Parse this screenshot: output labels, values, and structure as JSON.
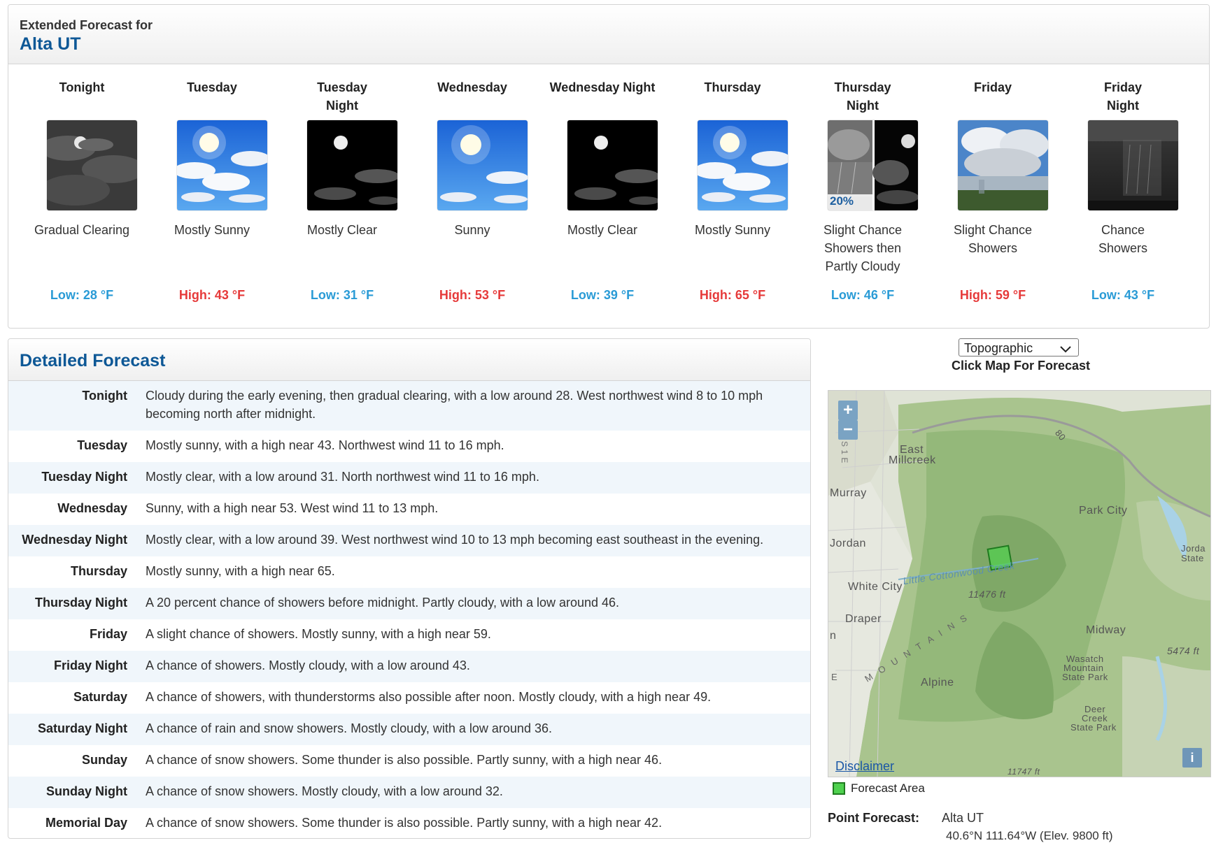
{
  "extended": {
    "subtitle": "Extended Forecast for",
    "location": "Alta UT",
    "days": [
      {
        "period": "Tonight",
        "short": "Gradual Clearing",
        "temp": "Low: 28 °F",
        "kind": "low",
        "icon": "night-cloudy-clearing-icon"
      },
      {
        "period": "Tuesday",
        "short": "Mostly Sunny",
        "temp": "High: 43 °F",
        "kind": "high",
        "icon": "mostly-sunny-icon"
      },
      {
        "period": "Tuesday Night",
        "short": "Mostly Clear",
        "temp": "Low: 31 °F",
        "kind": "low",
        "icon": "mostly-clear-night-icon"
      },
      {
        "period": "Wednesday",
        "short": "Sunny",
        "temp": "High: 53 °F",
        "kind": "high",
        "icon": "sunny-icon"
      },
      {
        "period": "Wednesday Night",
        "short": "Mostly Clear",
        "temp": "Low: 39 °F",
        "kind": "low",
        "icon": "mostly-clear-night-icon"
      },
      {
        "period": "Thursday",
        "short": "Mostly Sunny",
        "temp": "High: 65 °F",
        "kind": "high",
        "icon": "mostly-sunny-icon"
      },
      {
        "period": "Thursday Night",
        "short": "Slight Chance Showers then Partly Cloudy",
        "temp": "Low: 46 °F",
        "kind": "low",
        "icon": "showers-then-partly-cloudy-icon",
        "pop": "20%"
      },
      {
        "period": "Friday",
        "short": "Slight Chance Showers",
        "temp": "High: 59 °F",
        "kind": "high",
        "icon": "slight-chance-showers-icon"
      },
      {
        "period": "Friday Night",
        "short": "Chance Showers",
        "temp": "Low: 43 °F",
        "kind": "low",
        "icon": "chance-showers-night-icon"
      }
    ]
  },
  "detailed": {
    "title": "Detailed Forecast",
    "rows": [
      {
        "label": "Tonight",
        "text": "Cloudy during the early evening, then gradual clearing, with a low around 28. West northwest wind 8 to 10 mph becoming north after midnight."
      },
      {
        "label": "Tuesday",
        "text": "Mostly sunny, with a high near 43. Northwest wind 11 to 16 mph."
      },
      {
        "label": "Tuesday Night",
        "text": "Mostly clear, with a low around 31. North northwest wind 11 to 16 mph."
      },
      {
        "label": "Wednesday",
        "text": "Sunny, with a high near 53. West wind 11 to 13 mph."
      },
      {
        "label": "Wednesday Night",
        "text": "Mostly clear, with a low around 39. West northwest wind 10 to 13 mph becoming east southeast in the evening."
      },
      {
        "label": "Thursday",
        "text": "Mostly sunny, with a high near 65."
      },
      {
        "label": "Thursday Night",
        "text": "A 20 percent chance of showers before midnight. Partly cloudy, with a low around 46."
      },
      {
        "label": "Friday",
        "text": "A slight chance of showers. Mostly sunny, with a high near 59."
      },
      {
        "label": "Friday Night",
        "text": "A chance of showers. Mostly cloudy, with a low around 43."
      },
      {
        "label": "Saturday",
        "text": "A chance of showers, with thunderstorms also possible after noon. Mostly cloudy, with a high near 49."
      },
      {
        "label": "Saturday Night",
        "text": "A chance of rain and snow showers. Mostly cloudy, with a low around 36."
      },
      {
        "label": "Sunday",
        "text": "A chance of snow showers. Some thunder is also possible. Partly sunny, with a high near 46."
      },
      {
        "label": "Sunday Night",
        "text": "A chance of snow showers. Mostly cloudy, with a low around 32."
      },
      {
        "label": "Memorial Day",
        "text": "A chance of snow showers. Some thunder is also possible. Partly sunny, with a high near 42."
      }
    ]
  },
  "map": {
    "type_selected": "Topographic",
    "click_label": "Click Map For Forecast",
    "zoom_in": "+",
    "zoom_out": "−",
    "disclaimer": "Disclaimer",
    "info": "i",
    "places": {
      "east_millcreek_1": "East",
      "east_millcreek_2": "Millcreek",
      "murray": "Murray",
      "jordan": "Jordan",
      "park_city": "Park City",
      "jordanelle_1": "Jorda",
      "jordanelle_2": "State",
      "white_city": "White City",
      "draper": "Draper",
      "midway": "Midway",
      "wasatch_1": "Wasatch",
      "wasatch_2": "Mountain",
      "wasatch_3": "State Park",
      "alpine": "Alpine",
      "deer_1": "Deer",
      "deer_2": "Creek",
      "deer_3": "State Park",
      "creek": "Little Cottonwood Creek",
      "elev_1": "11476 ft",
      "elev_2": "5474 ft",
      "elev_3": "11747 ft",
      "mountains": "M O U N T A I N S",
      "hwy_80": "80",
      "hwy_215": "S 1 E",
      "left_n": "n",
      "left_e": "E"
    },
    "legend": "Forecast Area",
    "forecast_area_color": "#4fd14f"
  },
  "point": {
    "label": "Point Forecast:",
    "name": "Alta UT",
    "coords": "40.6°N 111.64°W (Elev. 9800 ft)"
  }
}
